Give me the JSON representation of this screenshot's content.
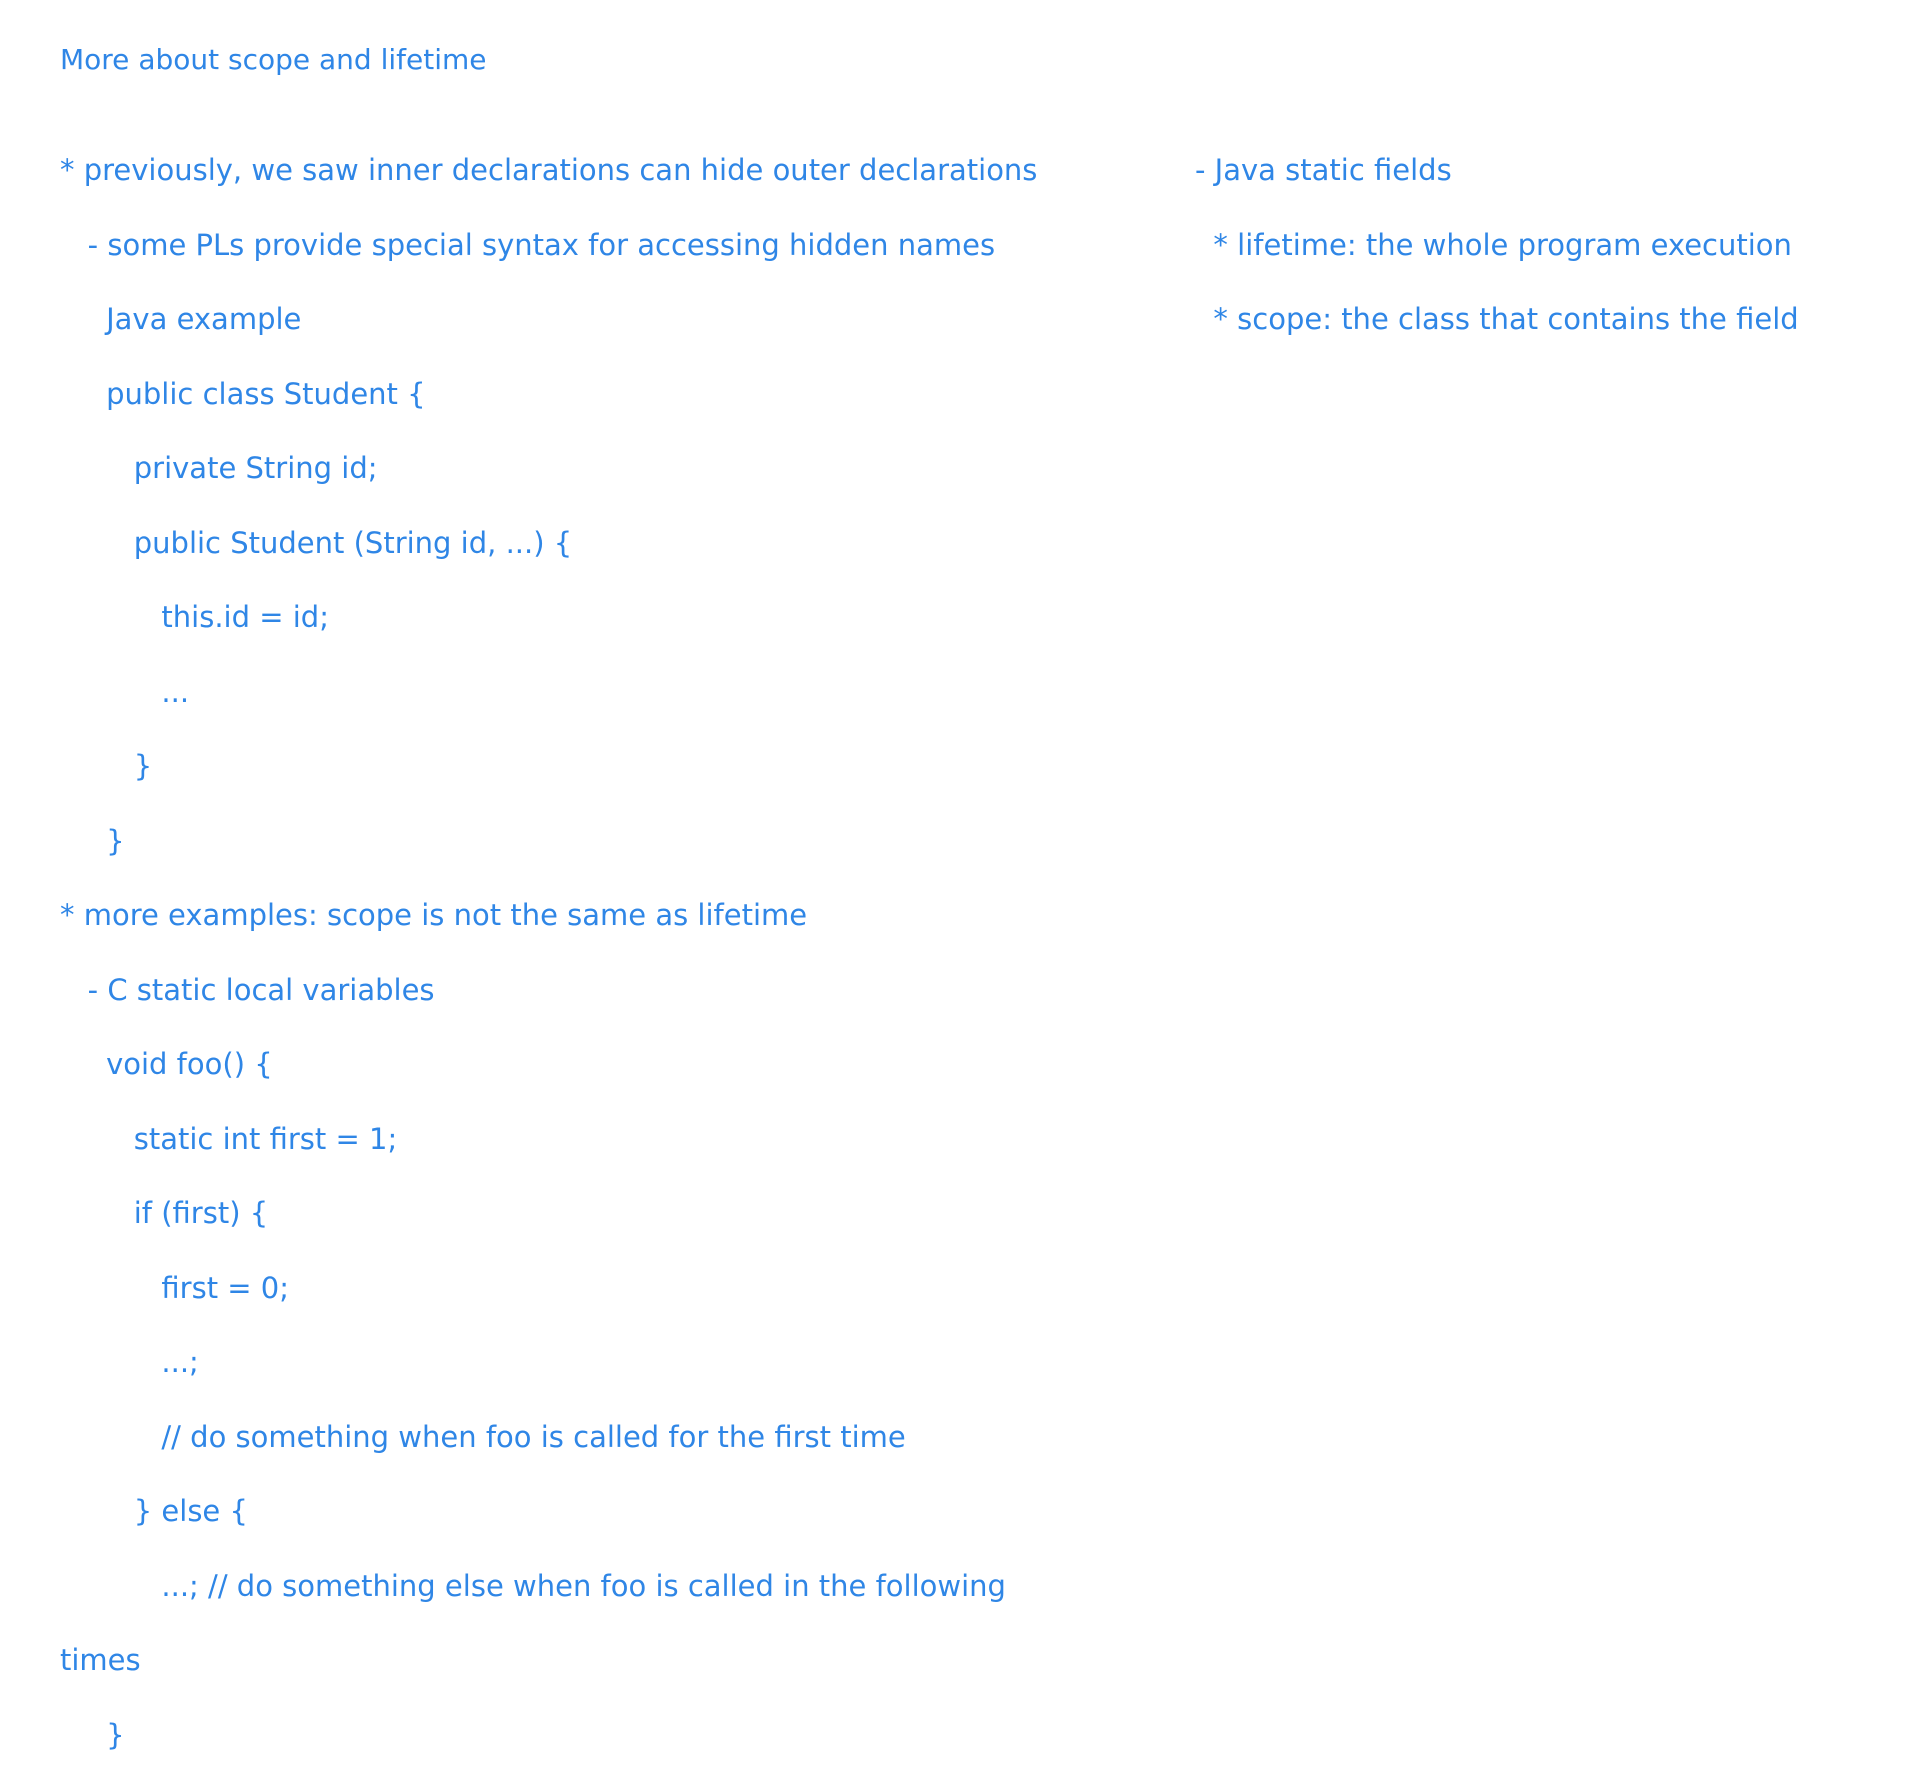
{
  "title": "More about scope and lifetime",
  "left_lines": [
    "* previously, we saw inner declarations can hide outer declarations",
    "   - some PLs provide special syntax for accessing hidden names",
    "     Java example",
    "     public class Student {",
    "        private String id;",
    "        public Student (String id, ...) {",
    "           this.id = id;",
    "           ...",
    "        }",
    "     }",
    "* more examples: scope is not the same as lifetime",
    "   - C static local variables",
    "     void foo() {",
    "        static int first = 1;",
    "        if (first) {",
    "           first = 0;",
    "           ...;",
    "           // do something when foo is called for the first time",
    "        } else {",
    "           ...; // do something else when foo is called in the following",
    "times",
    "     }"
  ],
  "right_lines": [
    "- Java static fields",
    "  * lifetime: the whole program execution",
    "  * scope: the class that contains the field"
  ]
}
